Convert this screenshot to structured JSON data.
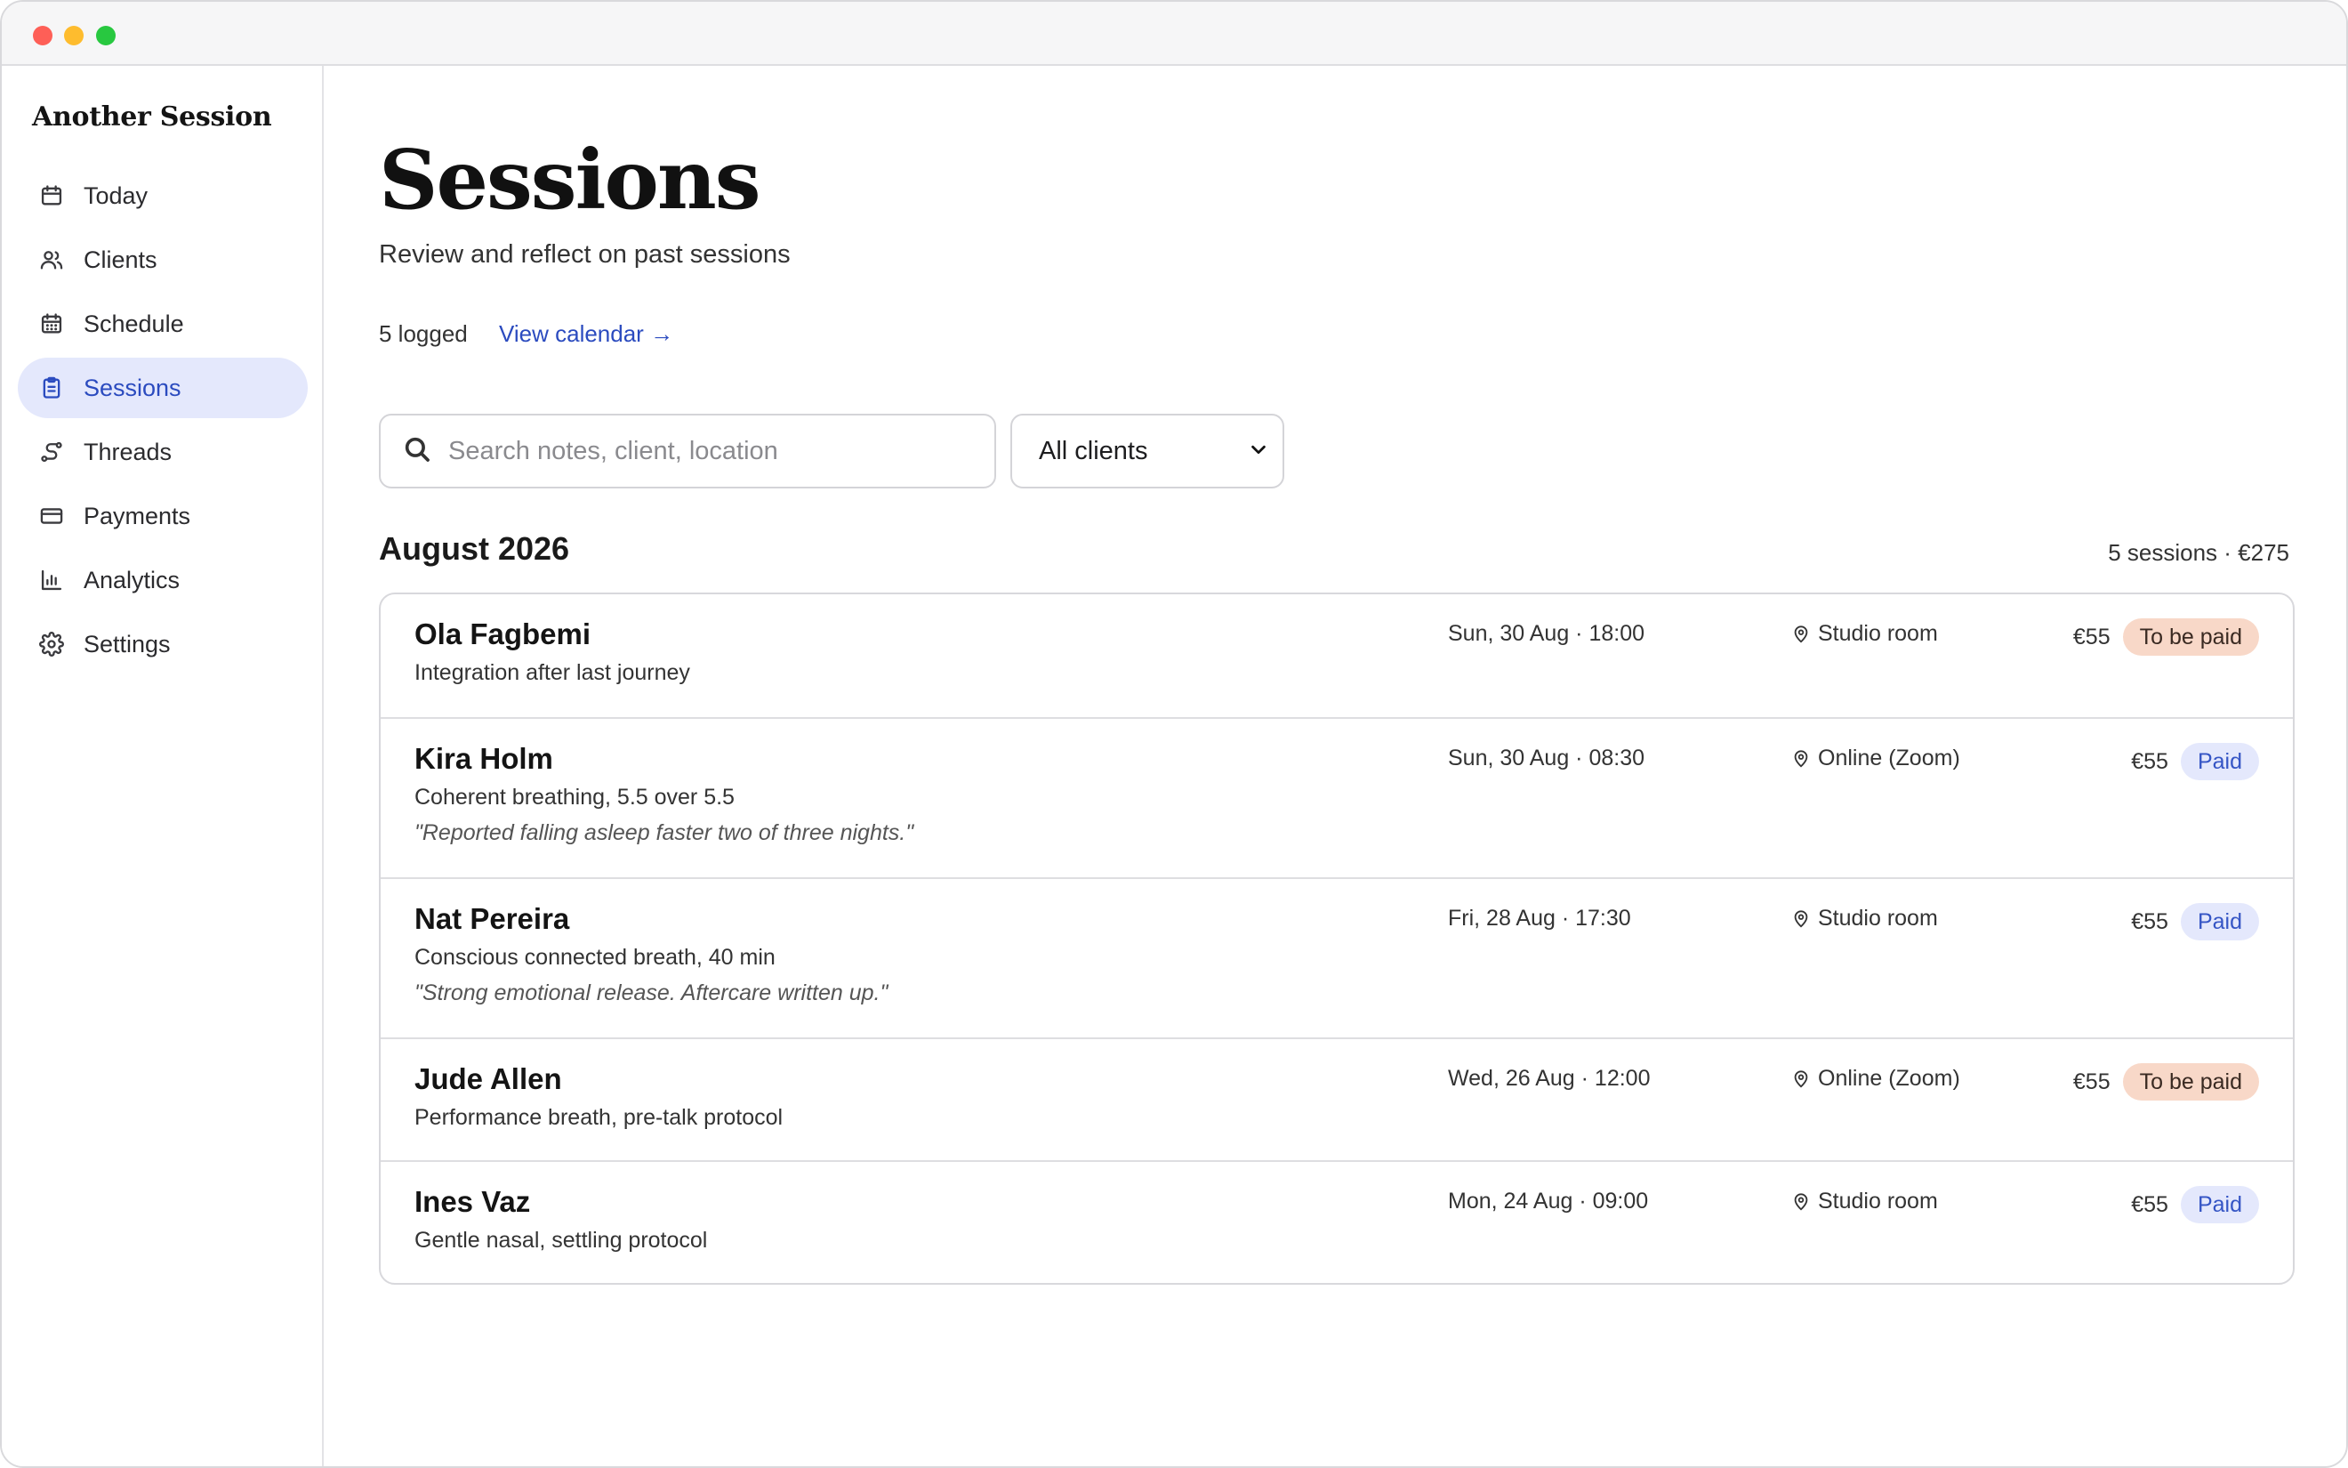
{
  "app": {
    "name": "Another Session"
  },
  "sidebar": {
    "items": [
      {
        "label": "Today",
        "icon": "calendar-icon",
        "active": false
      },
      {
        "label": "Clients",
        "icon": "users-icon",
        "active": false
      },
      {
        "label": "Schedule",
        "icon": "calendar-grid-icon",
        "active": false
      },
      {
        "label": "Sessions",
        "icon": "clipboard-icon",
        "active": true
      },
      {
        "label": "Threads",
        "icon": "thread-icon",
        "active": false
      },
      {
        "label": "Payments",
        "icon": "credit-card-icon",
        "active": false
      },
      {
        "label": "Analytics",
        "icon": "bar-chart-icon",
        "active": false
      },
      {
        "label": "Settings",
        "icon": "gear-icon",
        "active": false
      }
    ]
  },
  "page": {
    "title": "Sessions",
    "subtitle": "Review and reflect on past sessions",
    "logged": "5 logged",
    "view_calendar": "View calendar →"
  },
  "filters": {
    "search_placeholder": "Search notes, client, location",
    "client_select": "All clients"
  },
  "group": {
    "month": "August 2026",
    "summary": "5 sessions · €275"
  },
  "sessions": [
    {
      "client": "Ola Fagbemi",
      "protocol": "Integration after last journey",
      "note": "",
      "datetime": "Sun, 30 Aug · 18:00",
      "location": "Studio room",
      "amount": "€55",
      "status": "To be paid"
    },
    {
      "client": "Kira Holm",
      "protocol": "Coherent breathing, 5.5 over 5.5",
      "note": "\"Reported falling asleep faster two of three nights.\"",
      "datetime": "Sun, 30 Aug · 08:30",
      "location": "Online (Zoom)",
      "amount": "€55",
      "status": "Paid"
    },
    {
      "client": "Nat Pereira",
      "protocol": "Conscious connected breath, 40 min",
      "note": "\"Strong emotional release. Aftercare written up.\"",
      "datetime": "Fri, 28 Aug · 17:30",
      "location": "Studio room",
      "amount": "€55",
      "status": "Paid"
    },
    {
      "client": "Jude Allen",
      "protocol": "Performance breath, pre-talk protocol",
      "note": "",
      "datetime": "Wed, 26 Aug · 12:00",
      "location": "Online (Zoom)",
      "amount": "€55",
      "status": "To be paid"
    },
    {
      "client": "Ines Vaz",
      "protocol": "Gentle nasal, settling protocol",
      "note": "",
      "datetime": "Mon, 24 Aug · 09:00",
      "location": "Studio room",
      "amount": "€55",
      "status": "Paid"
    }
  ],
  "colors": {
    "accent": "#2b4bbf",
    "active_nav_bg": "#e4e8fc",
    "unpaid_badge_bg": "#f8d8c8",
    "paid_badge_bg": "#e4e8fc"
  }
}
